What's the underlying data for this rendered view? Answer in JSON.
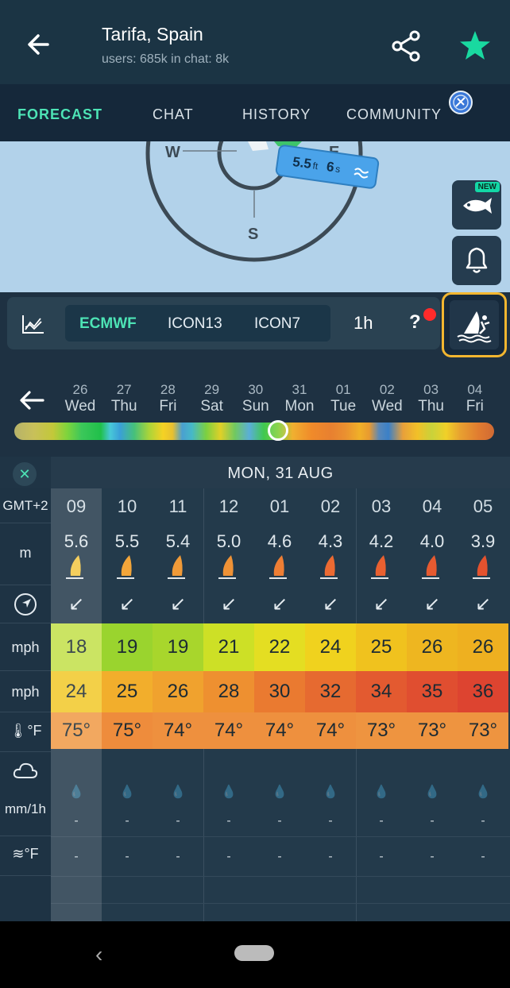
{
  "header": {
    "title": "Tarifa, Spain",
    "subtitle": "users: 685k in chat: 8k"
  },
  "tabs": [
    {
      "label": "FORECAST",
      "active": true
    },
    {
      "label": "CHAT"
    },
    {
      "label": "HISTORY"
    },
    {
      "label": "COMMUNITY"
    }
  ],
  "map": {
    "compass": {
      "w": "W",
      "e": "E",
      "s": "S"
    },
    "wave_height": "5.5",
    "wave_height_unit": "ft",
    "wave_period": "6",
    "wave_period_unit": "s",
    "new_badge": "NEW"
  },
  "modelbar": {
    "models": [
      "ECMWF",
      "ICON13",
      "ICON7"
    ],
    "active_model": "ECMWF",
    "interval": "1h",
    "help": "?"
  },
  "days": [
    {
      "d": "26",
      "w": "Wed"
    },
    {
      "d": "27",
      "w": "Thu"
    },
    {
      "d": "28",
      "w": "Fri"
    },
    {
      "d": "29",
      "w": "Sat"
    },
    {
      "d": "30",
      "w": "Sun"
    },
    {
      "d": "31",
      "w": "Mon"
    },
    {
      "d": "01",
      "w": "Tue"
    },
    {
      "d": "02",
      "w": "Wed"
    },
    {
      "d": "03",
      "w": "Thu"
    },
    {
      "d": "04",
      "w": "Fri"
    }
  ],
  "table": {
    "date": "MON,  31 AUG",
    "labels": {
      "tz": "GMT+2",
      "wave": "m",
      "wind": "mph",
      "gust": "mph",
      "temp": "°F",
      "rain": "mm/1h",
      "water_temp": "°F"
    },
    "hours": [
      "09",
      "10",
      "11",
      "12",
      "01",
      "02",
      "03",
      "04",
      "05"
    ],
    "waves": [
      "5.6",
      "5.5",
      "5.4",
      "5.0",
      "4.6",
      "4.3",
      "4.2",
      "4.0",
      "3.9"
    ],
    "sail_colors": [
      "#f3c644",
      "#f2a53a",
      "#f09a38",
      "#ef9236",
      "#ee7e34",
      "#ec6a32",
      "#e96030",
      "#e65a30",
      "#e4522e"
    ],
    "wind": [
      "18",
      "19",
      "19",
      "21",
      "22",
      "24",
      "25",
      "26",
      "26"
    ],
    "wind_colors": [
      "#c3e04a",
      "#9ad42e",
      "#a8d62c",
      "#cde026",
      "#e4de22",
      "#f0d21e",
      "#f0c21e",
      "#eeb620",
      "#eeb020"
    ],
    "gust": [
      "24",
      "25",
      "26",
      "28",
      "30",
      "32",
      "34",
      "35",
      "36"
    ],
    "gust_colors": [
      "#f2c92a",
      "#f2ae2c",
      "#f0a22e",
      "#ee9030",
      "#ea7a30",
      "#e66a30",
      "#e35a30",
      "#e04e30",
      "#dd4430"
    ],
    "temp": [
      "75°",
      "75°",
      "74°",
      "74°",
      "74°",
      "74°",
      "73°",
      "73°",
      "73°"
    ],
    "temp_colors": [
      "#f09a46",
      "#ee8c3c",
      "#ee903e",
      "#ee903e",
      "#ee903e",
      "#ee903e",
      "#ee9440",
      "#ee9440",
      "#ee9440"
    ],
    "rain": [
      "-",
      "-",
      "-",
      "-",
      "-",
      "-",
      "-",
      "-",
      "-"
    ],
    "water": [
      "-",
      "-",
      "-",
      "-",
      "-",
      "-",
      "-",
      "-",
      "-"
    ]
  },
  "nav": {
    "back": "‹"
  }
}
